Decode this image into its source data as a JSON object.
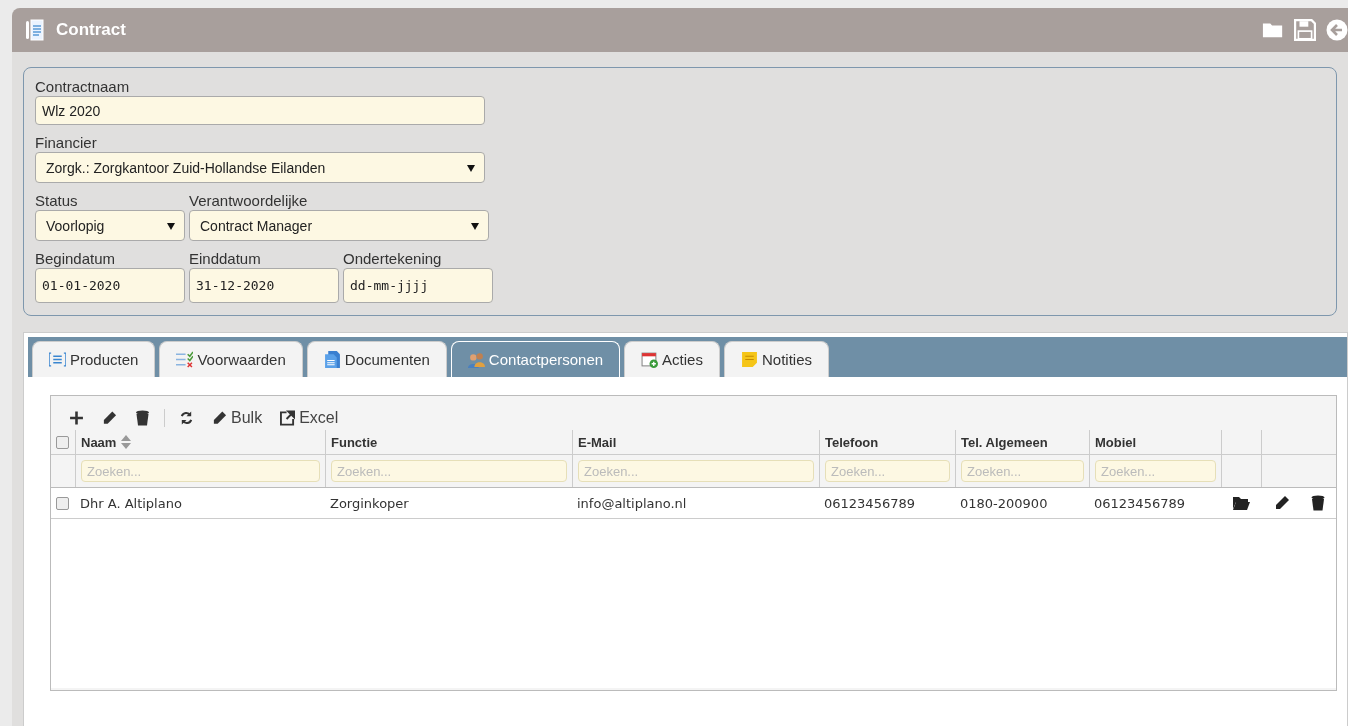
{
  "window": {
    "title": "Contract"
  },
  "form": {
    "rows": [
      [
        {
          "label": "Contractnaam",
          "kind": "text",
          "value": "Wlz 2020"
        }
      ],
      [
        {
          "label": "Financier",
          "kind": "select",
          "value": "Zorgk.: Zorgkantoor Zuid-Hollandse Eilanden"
        }
      ],
      [
        {
          "label": "Status",
          "kind": "select",
          "value": "Voorlopig"
        },
        {
          "label": "Verantwoordelijke",
          "kind": "select",
          "value": "Contract Manager"
        }
      ],
      [
        {
          "label": "Begindatum",
          "kind": "date",
          "value": "01-01-2020"
        },
        {
          "label": "Einddatum",
          "kind": "date",
          "value": "31-12-2020"
        },
        {
          "label": "Ondertekening",
          "kind": "date",
          "placeholder": "dd-mm-jjjj"
        }
      ]
    ]
  },
  "tabs": [
    {
      "label": "Producten",
      "selected": false
    },
    {
      "label": "Voorwaarden",
      "selected": false
    },
    {
      "label": "Documenten",
      "selected": false
    },
    {
      "label": "Contactpersonen",
      "selected": true
    },
    {
      "label": "Acties",
      "selected": false
    },
    {
      "label": "Notities",
      "selected": false
    }
  ],
  "toolbar": [
    {
      "kind": "add"
    },
    {
      "kind": "edit"
    },
    {
      "kind": "delete"
    },
    {
      "kind": "separator"
    },
    {
      "kind": "refresh"
    },
    {
      "kind": "bulk",
      "label": "Bulk"
    },
    {
      "kind": "export",
      "label": "Excel"
    }
  ],
  "table": {
    "select_all": {
      "checked": false
    },
    "columns": [
      {
        "label": "Naam",
        "sortable": true,
        "filter_placeholder": "Zoeken..."
      },
      {
        "label": "Functie",
        "sortable": false,
        "filter_placeholder": "Zoeken..."
      },
      {
        "label": "E-Mail",
        "sortable": false,
        "filter_placeholder": "Zoeken..."
      },
      {
        "label": "Telefoon",
        "sortable": false,
        "filter_placeholder": "Zoeken..."
      },
      {
        "label": "Tel. Algemeen",
        "sortable": false,
        "filter_placeholder": "Zoeken..."
      },
      {
        "label": "Mobiel",
        "sortable": false,
        "filter_placeholder": "Zoeken..."
      }
    ],
    "rows": [
      {
        "checked": false,
        "cells": [
          "Dhr A. Altiplano",
          "Zorginkoper",
          "info@altiplano.nl",
          "06123456789",
          "0180-200900",
          "06123456789"
        ]
      }
    ]
  }
}
